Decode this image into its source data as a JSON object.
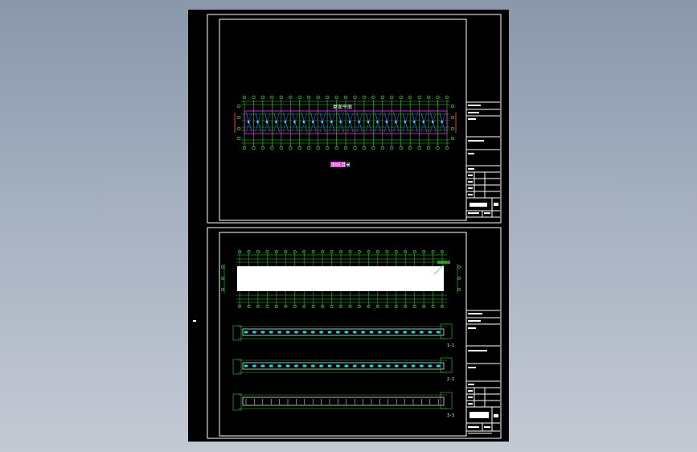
{
  "drawing": {
    "colors": {
      "background": "#000000",
      "frame": "#ffffff",
      "grid": "#33cc33",
      "axis_bubble": "#33ff33",
      "member": "#4466ff",
      "dimension": "#ff3333",
      "highlight": "#ff33ff",
      "cyan": "#00ffff"
    },
    "top_sheet": {
      "plan_title": "屋面平面",
      "view_label": "图纸目录"
    },
    "bottom_sheet": {
      "section_labels": [
        "1-1",
        "2-2",
        "3-3"
      ]
    }
  }
}
